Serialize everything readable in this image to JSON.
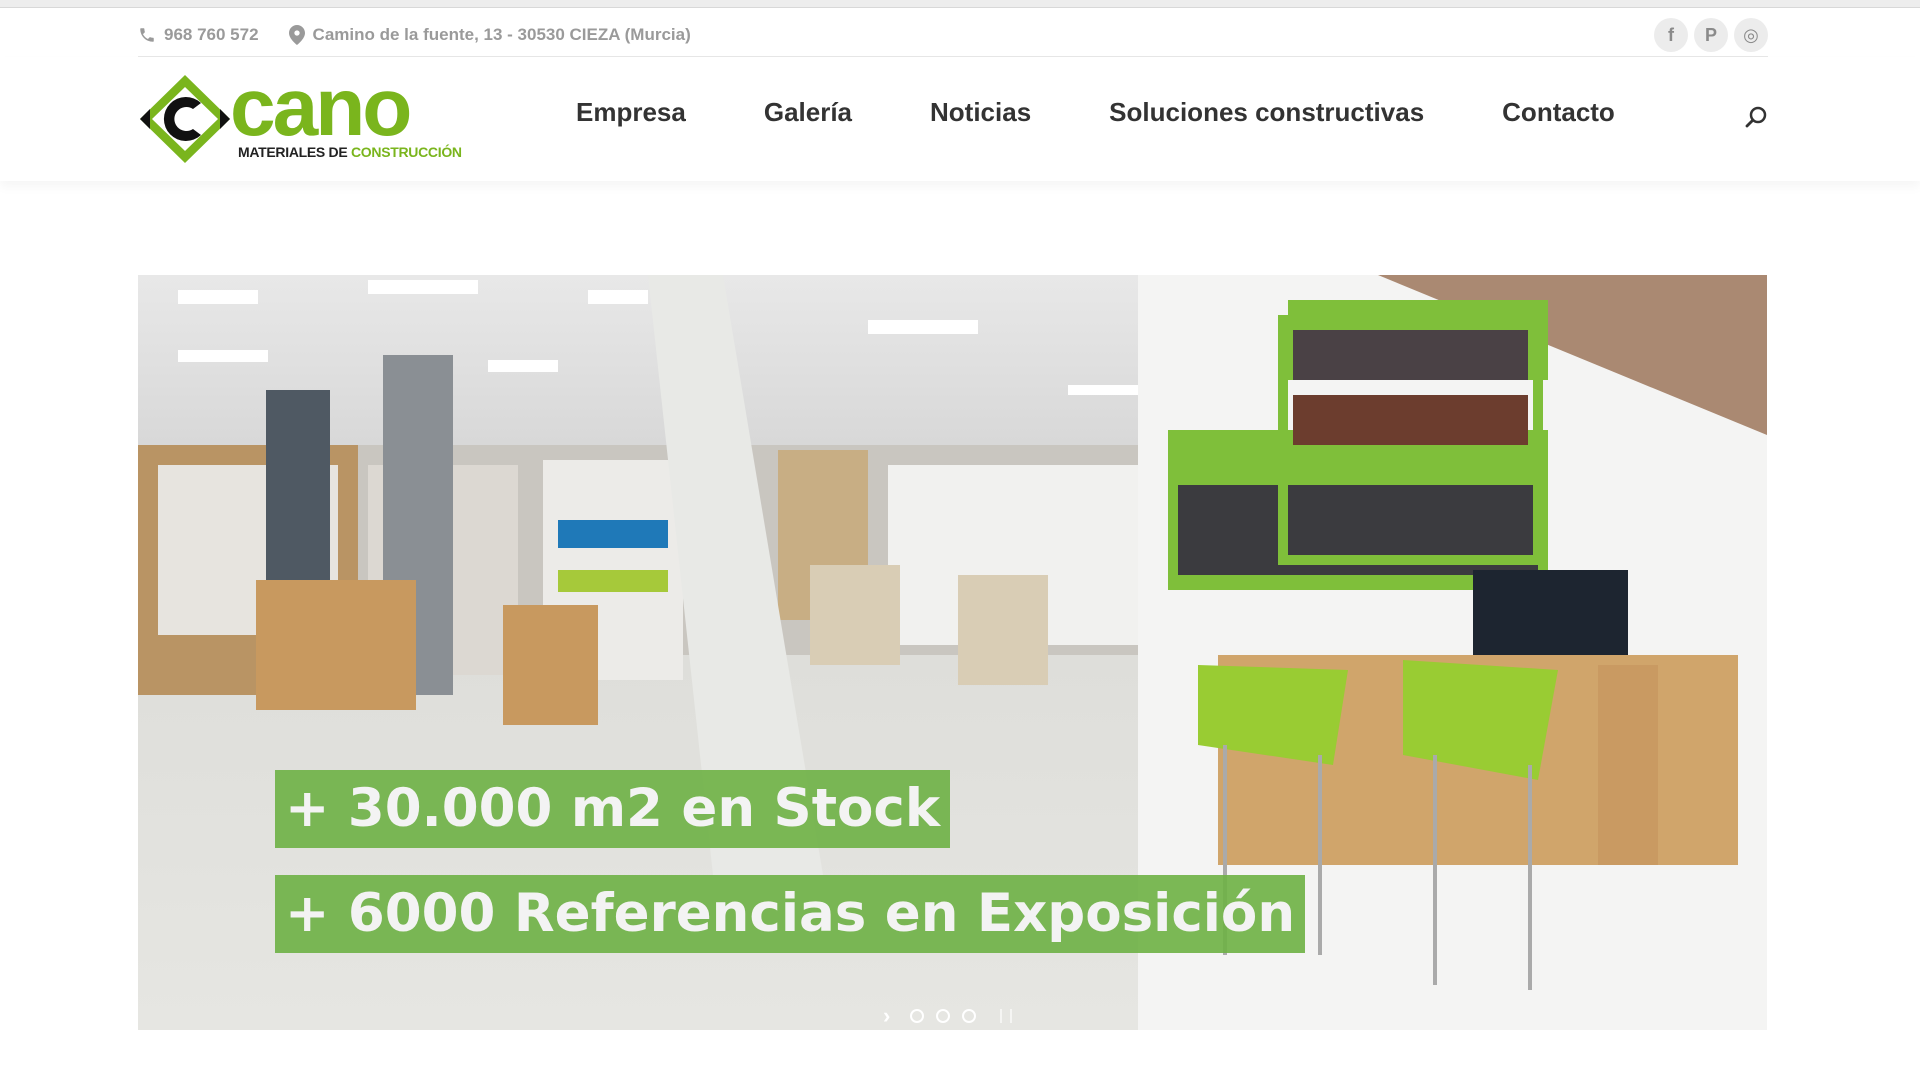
{
  "topbar": {
    "phone": "968 760 572",
    "address": "Camino de la fuente, 13 - 30530 CIEZA (Murcia)",
    "social": [
      {
        "icon": "facebook-icon",
        "glyph": "f"
      },
      {
        "icon": "pinterest-icon",
        "glyph": "P"
      },
      {
        "icon": "instagram-icon",
        "glyph": "◎"
      }
    ]
  },
  "logo": {
    "word": "cano",
    "subtitle_a": "MATERIALES DE ",
    "subtitle_b": "CONSTRUCCIÓN"
  },
  "nav": {
    "items": [
      "Empresa",
      "Galería",
      "Noticias",
      "Soluciones constructivas",
      "Contacto"
    ]
  },
  "hero": {
    "line1": "+ 30.000 m2 en Stock",
    "line2": "+ 6000 Referencias en Exposición",
    "slides": 3,
    "active_slide": 1
  },
  "colors": {
    "brand_green": "#7ab51d",
    "banner_green": "#70b248",
    "text_dark": "#333333",
    "text_muted": "#9a9a9a"
  }
}
